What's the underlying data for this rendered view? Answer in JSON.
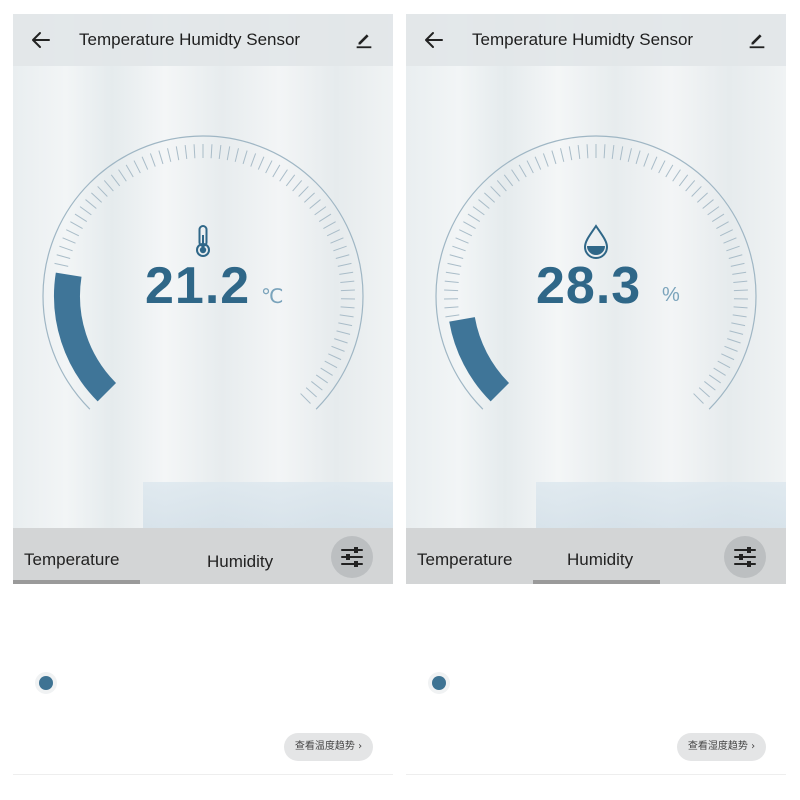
{
  "colors": {
    "accent": "#3f7598",
    "value_text": "#2f6788",
    "unit_text": "#7aa3bb"
  },
  "screens": {
    "left": {
      "header": {
        "title": "Temperature Humidty Sensor",
        "back_icon": "arrow-left-icon",
        "edit_icon": "pencil-icon"
      },
      "gauge": {
        "icon": "thermometer-icon",
        "value": "21.2",
        "unit": "℃",
        "fill_fraction": 0.2
      },
      "tabs": [
        {
          "label": "Temperature",
          "selected": true
        },
        {
          "label": "Humidity",
          "selected": false
        }
      ],
      "settings_icon": "sliders-icon",
      "trend_button": {
        "label": "查看温度趋势",
        "chevron": "›"
      }
    },
    "right": {
      "header": {
        "title": "Temperature Humidty Sensor",
        "back_icon": "arrow-left-icon",
        "edit_icon": "pencil-icon"
      },
      "gauge": {
        "icon": "water-drop-icon",
        "value": "28.3",
        "unit": "%",
        "fill_fraction": 0.13
      },
      "tabs": [
        {
          "label": "Temperature",
          "selected": false
        },
        {
          "label": "Humidity",
          "selected": true
        }
      ],
      "settings_icon": "sliders-icon",
      "trend_button": {
        "label": "查看湿度趋势",
        "chevron": "›"
      }
    }
  }
}
